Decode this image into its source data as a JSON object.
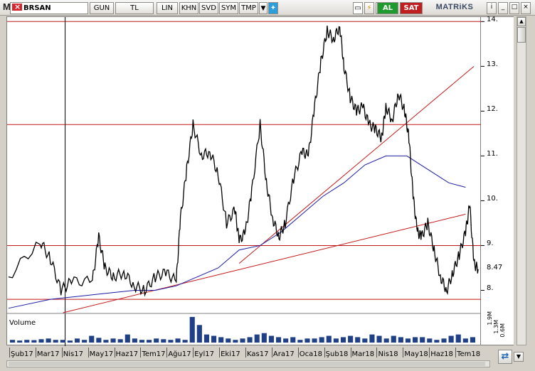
{
  "toolbar": {
    "logo": "M",
    "symbol": "BRSAN",
    "period": "GUN",
    "currency": "TL",
    "scale": "LIN",
    "buttons": [
      "KHN",
      "SVD",
      "SYM",
      "TMP"
    ],
    "twitter_icon": "twitter-icon",
    "buy_label": "AL",
    "sell_label": "SAT",
    "brand": "MATRiKS",
    "colors": {
      "buy": "#1f9a2e",
      "sell": "#c11f1f",
      "twitter": "#2c9ed9"
    }
  },
  "volume": {
    "label": "Volume",
    "ticks": [
      "1.9M",
      "1.3M",
      "0.6M"
    ]
  },
  "chart_data": {
    "type": "line",
    "title": "",
    "symbol": "BRSAN",
    "ylabel": "",
    "xlabel": "",
    "ylim": [
      7.5,
      14.1
    ],
    "y_ticks": [
      8.0,
      9.0,
      10.0,
      11.0,
      12.0,
      13.0,
      14.0
    ],
    "last_price": 8.47,
    "x_ticks": [
      "Şub17",
      "Mar17",
      "Nis17",
      "May17",
      "Haz17",
      "Tem17",
      "Ağu17",
      "Eyl17",
      "Eki17",
      "Kas17",
      "Ara17",
      "Oca18",
      "Şub18",
      "Mar18",
      "Nis18",
      "May18",
      "Haz18",
      "Tem18"
    ],
    "price": [
      [
        0,
        8.3
      ],
      [
        1.5,
        9.1
      ],
      [
        2,
        8.7
      ],
      [
        2.5,
        8.0
      ],
      [
        3,
        8.2
      ],
      [
        4,
        8.2
      ],
      [
        4.3,
        9.2
      ],
      [
        4.6,
        8.5
      ],
      [
        5,
        8.3
      ],
      [
        5.5,
        8.4
      ],
      [
        6,
        8.1
      ],
      [
        6.5,
        8.0
      ],
      [
        7,
        8.3
      ],
      [
        7.5,
        8.4
      ],
      [
        8,
        8.2
      ],
      [
        8.2,
        9.6
      ],
      [
        8.5,
        10.7
      ],
      [
        8.8,
        11.7
      ],
      [
        9.2,
        11.0
      ],
      [
        9.6,
        11.1
      ],
      [
        10,
        10.6
      ],
      [
        10.4,
        9.5
      ],
      [
        10.8,
        9.8
      ],
      [
        11,
        9.1
      ],
      [
        11.3,
        9.3
      ],
      [
        11.6,
        10.2
      ],
      [
        12,
        11.7
      ],
      [
        12.3,
        10.4
      ],
      [
        12.6,
        9.6
      ],
      [
        12.9,
        9.2
      ],
      [
        13.2,
        9.5
      ],
      [
        13.6,
        10.5
      ],
      [
        14,
        11.1
      ],
      [
        14.3,
        11.0
      ],
      [
        14.6,
        12.1
      ],
      [
        14.9,
        13.1
      ],
      [
        15.2,
        13.8
      ],
      [
        15.5,
        13.6
      ],
      [
        15.8,
        13.9
      ],
      [
        16,
        13.0
      ],
      [
        16.3,
        12.3
      ],
      [
        16.6,
        12.0
      ],
      [
        16.9,
        12.1
      ],
      [
        17.2,
        11.7
      ],
      [
        17.5,
        11.6
      ],
      [
        17.8,
        11.4
      ],
      [
        18,
        12.1
      ],
      [
        18.3,
        11.8
      ],
      [
        18.6,
        12.4
      ],
      [
        18.9,
        12.0
      ],
      [
        19.1,
        11.4
      ],
      [
        19.3,
        10.1
      ],
      [
        19.5,
        9.3
      ],
      [
        19.7,
        9.2
      ],
      [
        20,
        9.5
      ],
      [
        20.3,
        8.9
      ],
      [
        20.6,
        8.3
      ],
      [
        20.9,
        8.0
      ],
      [
        21.2,
        8.4
      ],
      [
        21.5,
        8.8
      ],
      [
        21.8,
        9.3
      ],
      [
        22,
        9.9
      ],
      [
        22.2,
        8.6
      ],
      [
        22.4,
        8.47
      ]
    ],
    "moving_average": [
      [
        0,
        7.6
      ],
      [
        2,
        7.8
      ],
      [
        4,
        7.9
      ],
      [
        6,
        8.0
      ],
      [
        7,
        8.0
      ],
      [
        8,
        8.1
      ],
      [
        9,
        8.3
      ],
      [
        10,
        8.5
      ],
      [
        11,
        8.9
      ],
      [
        12,
        9.0
      ],
      [
        13,
        9.3
      ],
      [
        14,
        9.7
      ],
      [
        15,
        10.1
      ],
      [
        16,
        10.4
      ],
      [
        17,
        10.8
      ],
      [
        18,
        11.0
      ],
      [
        19,
        11.0
      ],
      [
        20,
        10.7
      ],
      [
        21,
        10.4
      ],
      [
        21.8,
        10.3
      ]
    ],
    "horizontal_lines": [
      14.0,
      11.7,
      9.0,
      7.8
    ],
    "trendlines": [
      {
        "from": [
          2.6,
          7.5
        ],
        "to": [
          21.8,
          9.7
        ]
      },
      {
        "from": [
          11,
          8.6
        ],
        "to": [
          22.2,
          13.0
        ]
      }
    ],
    "vertical_marker_x": 2.7,
    "volume_values": [
      0.2,
      0.15,
      0.2,
      0.18,
      0.25,
      0.3,
      0.2,
      0.2,
      0.15,
      0.3,
      0.2,
      0.5,
      0.35,
      0.2,
      0.3,
      0.25,
      0.6,
      0.3,
      0.2,
      0.2,
      0.3,
      0.25,
      0.2,
      0.3,
      0.2,
      1.9,
      1.3,
      0.6,
      0.5,
      0.4,
      0.3,
      0.2,
      0.3,
      0.4,
      0.6,
      0.7,
      0.5,
      0.4,
      0.3,
      0.4,
      0.2,
      0.3,
      0.3,
      0.4,
      0.5,
      0.3,
      0.4,
      0.5,
      0.4,
      0.3,
      0.6,
      0.5,
      0.3,
      0.5,
      0.4,
      0.3,
      0.4,
      0.4,
      0.3,
      0.2,
      0.3,
      0.5,
      0.6,
      0.3,
      0.4
    ],
    "colors": {
      "price": "#000000",
      "moving_average": "#1a1aa6",
      "lines": "#c41818"
    },
    "grid": false,
    "legend": "none"
  }
}
